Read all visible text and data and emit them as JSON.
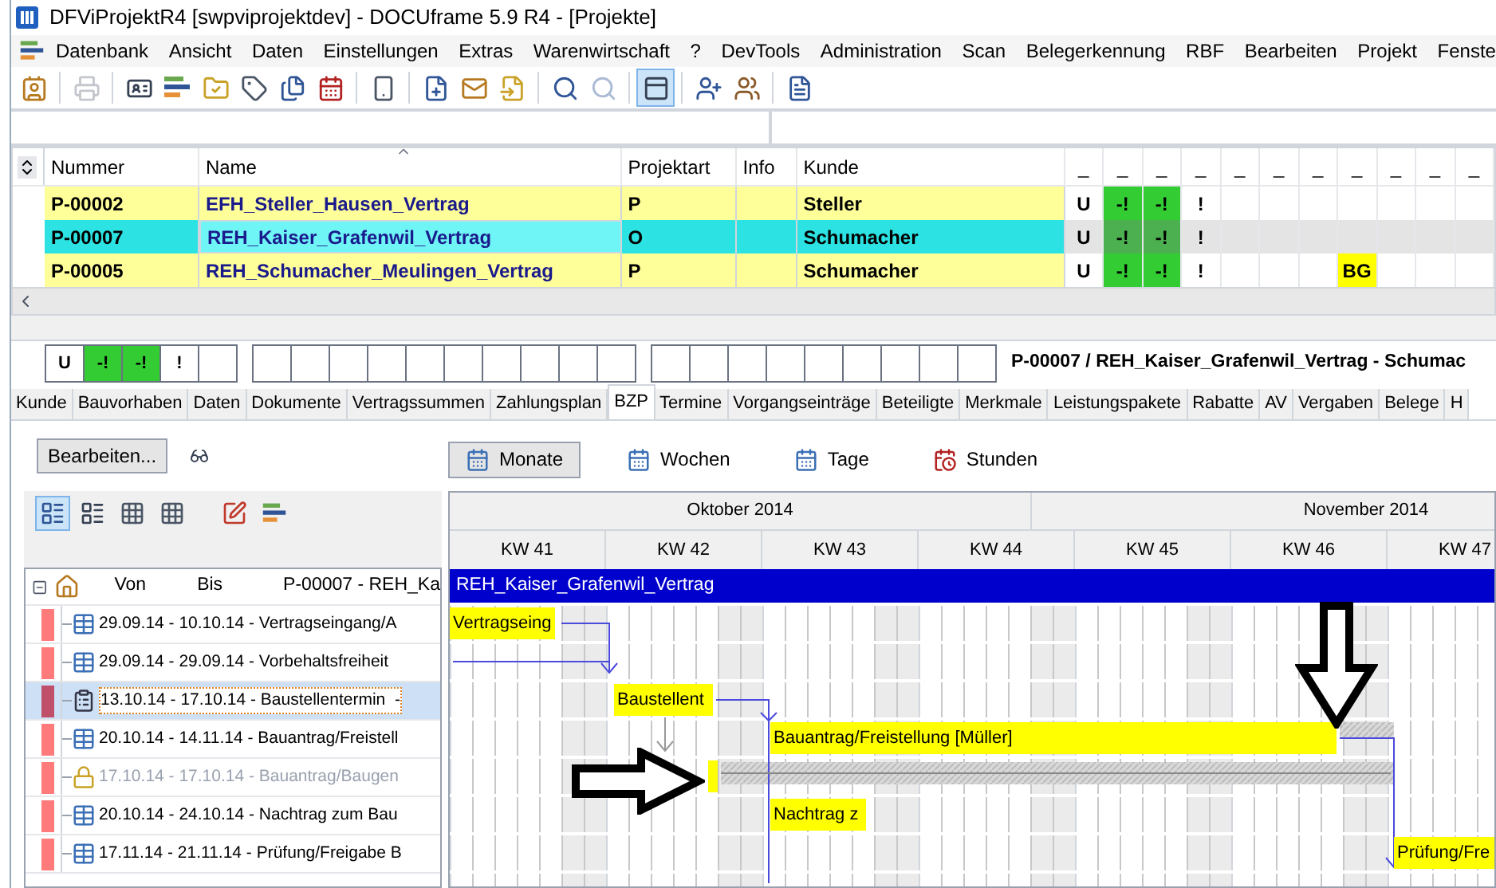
{
  "window": {
    "title": "DFViProjektR4 [swpviprojektdev] - DOCUframe 5.9 R4 - [Projekte]"
  },
  "menu": [
    "Datenbank",
    "Ansicht",
    "Daten",
    "Einstellungen",
    "Extras",
    "Warenwirtschaft",
    "?",
    "DevTools",
    "Administration",
    "Scan",
    "Belegerkennung",
    "RBF",
    "Bearbeiten",
    "Projekt",
    "Fenste"
  ],
  "toolbar": [
    {
      "kind": "contacts",
      "disabled": false,
      "selected": false
    },
    {
      "kind": "separator"
    },
    {
      "kind": "printer",
      "disabled": true,
      "selected": false
    },
    {
      "kind": "separator"
    },
    {
      "kind": "card",
      "disabled": false,
      "selected": false
    },
    {
      "kind": "bars",
      "disabled": false,
      "selected": false
    },
    {
      "kind": "folder",
      "disabled": false,
      "selected": false
    },
    {
      "kind": "tag",
      "disabled": false,
      "selected": false
    },
    {
      "kind": "documents",
      "disabled": false,
      "selected": false
    },
    {
      "kind": "calendar",
      "disabled": false,
      "selected": false
    },
    {
      "kind": "separator"
    },
    {
      "kind": "phone",
      "disabled": false,
      "selected": false
    },
    {
      "kind": "separator"
    },
    {
      "kind": "new-document",
      "disabled": false,
      "selected": false
    },
    {
      "kind": "new-mail",
      "disabled": false,
      "selected": false
    },
    {
      "kind": "new-note",
      "disabled": false,
      "selected": false
    },
    {
      "kind": "separator"
    },
    {
      "kind": "search",
      "disabled": false,
      "selected": false
    },
    {
      "kind": "search",
      "disabled": true,
      "selected": false
    },
    {
      "kind": "separator"
    },
    {
      "kind": "panel",
      "disabled": false,
      "selected": true
    },
    {
      "kind": "separator"
    },
    {
      "kind": "user-add",
      "disabled": false,
      "selected": false
    },
    {
      "kind": "users",
      "disabled": false,
      "selected": false
    },
    {
      "kind": "separator"
    },
    {
      "kind": "export",
      "disabled": false,
      "selected": false
    }
  ],
  "table": {
    "columns": [
      "Nummer",
      "Name",
      "Projektart",
      "Info",
      "Kunde"
    ],
    "flag_columns": [
      "_",
      "_",
      "_",
      "_",
      "_",
      "_",
      "_",
      "_",
      "_",
      "_",
      "_"
    ],
    "rows": [
      {
        "nummer": "P-00002",
        "name": "EFH_Steller_Hausen_Vertrag",
        "projektart": "P",
        "kunde": "Steller",
        "selected": false,
        "flags": [
          {
            "kind": "text",
            "text": "U"
          },
          {
            "kind": "ok",
            "text": "-!"
          },
          {
            "kind": "ok",
            "text": "-!"
          },
          {
            "kind": "text",
            "text": "!"
          },
          {
            "kind": "empty"
          },
          {
            "kind": "empty"
          },
          {
            "kind": "empty"
          },
          {
            "kind": "empty"
          },
          {
            "kind": "empty"
          },
          {
            "kind": "empty"
          },
          {
            "kind": "empty"
          }
        ]
      },
      {
        "nummer": "P-00007",
        "name": "REH_Kaiser_Grafenwil_Vertrag",
        "projektart": "O",
        "kunde": "Schumacher",
        "selected": true,
        "flags": [
          {
            "kind": "text",
            "text": "U"
          },
          {
            "kind": "ok",
            "text": "-!"
          },
          {
            "kind": "ok",
            "text": "-!"
          },
          {
            "kind": "text",
            "text": "!"
          },
          {
            "kind": "empty"
          },
          {
            "kind": "empty"
          },
          {
            "kind": "empty"
          },
          {
            "kind": "empty"
          },
          {
            "kind": "empty"
          },
          {
            "kind": "empty"
          },
          {
            "kind": "empty"
          }
        ]
      },
      {
        "nummer": "P-00005",
        "name": "REH_Schumacher_Meulingen_Vertrag",
        "projektart": "P",
        "kunde": "Schumacher",
        "selected": false,
        "flags": [
          {
            "kind": "text",
            "text": "U"
          },
          {
            "kind": "ok",
            "text": "-!"
          },
          {
            "kind": "ok",
            "text": "-!"
          },
          {
            "kind": "text",
            "text": "!"
          },
          {
            "kind": "empty"
          },
          {
            "kind": "empty"
          },
          {
            "kind": "empty"
          },
          {
            "kind": "warn",
            "text": "BG"
          },
          {
            "kind": "empty"
          },
          {
            "kind": "empty"
          },
          {
            "kind": "empty"
          }
        ]
      }
    ]
  },
  "detail": {
    "flag_groups": [
      [
        {
          "kind": "text",
          "text": "U"
        },
        {
          "kind": "ok",
          "text": "-!"
        },
        {
          "kind": "ok",
          "text": "-!"
        },
        {
          "kind": "text",
          "text": "!"
        },
        {
          "kind": "empty"
        }
      ],
      [
        {
          "kind": "empty"
        },
        {
          "kind": "empty"
        },
        {
          "kind": "empty"
        },
        {
          "kind": "empty"
        },
        {
          "kind": "empty"
        },
        {
          "kind": "empty"
        },
        {
          "kind": "empty"
        },
        {
          "kind": "empty"
        },
        {
          "kind": "empty"
        },
        {
          "kind": "empty"
        }
      ],
      [
        {
          "kind": "empty"
        },
        {
          "kind": "empty"
        },
        {
          "kind": "empty"
        },
        {
          "kind": "empty"
        },
        {
          "kind": "empty"
        },
        {
          "kind": "empty"
        },
        {
          "kind": "empty"
        },
        {
          "kind": "empty"
        },
        {
          "kind": "empty"
        }
      ]
    ],
    "title": "P-00007 / REH_Kaiser_Grafenwil_Vertrag - Schumac"
  },
  "tabs": [
    {
      "label": "Kunde",
      "selected": false
    },
    {
      "label": "Bauvorhaben",
      "selected": false
    },
    {
      "label": "Daten",
      "selected": false
    },
    {
      "label": "Dokumente",
      "selected": false
    },
    {
      "label": "Vertragssummen",
      "selected": false
    },
    {
      "label": "Zahlungsplan",
      "selected": false
    },
    {
      "label": "BZP",
      "selected": true
    },
    {
      "label": "Termine",
      "selected": false
    },
    {
      "label": "Vorgangseinträge",
      "selected": false
    },
    {
      "label": "Beteiligte",
      "selected": false
    },
    {
      "label": "Merkmale",
      "selected": false
    },
    {
      "label": "Leistungspakete",
      "selected": false
    },
    {
      "label": "Rabatte",
      "selected": false
    },
    {
      "label": "AV",
      "selected": false
    },
    {
      "label": "Vergaben",
      "selected": false
    },
    {
      "label": "Belege",
      "selected": false
    },
    {
      "label": "H",
      "selected": false
    }
  ],
  "edit_button": "Bearbeiten...",
  "tree_tools": [
    {
      "kind": "gantt",
      "selected": true
    },
    {
      "kind": "form",
      "selected": false
    },
    {
      "kind": "table",
      "selected": false
    },
    {
      "kind": "table",
      "selected": false
    },
    {
      "kind": "edit",
      "selected": false
    },
    {
      "kind": "bars",
      "selected": false
    }
  ],
  "tree": {
    "expanded": true,
    "von": "Von",
    "bis": "Bis",
    "title": "P-00007 - REH_Ka",
    "rows": [
      {
        "kind": "calendar",
        "text": "29.09.14 - 10.10.14 - Vertragseingang/A",
        "selected": false,
        "disabled": false
      },
      {
        "kind": "calendar",
        "text": "29.09.14 - 29.09.14 - Vorbehaltsfreiheit",
        "selected": false,
        "disabled": false
      },
      {
        "kind": "clipboard",
        "text": "13.10.14 - 17.10.14 - Baustellentermin  -",
        "selected": true,
        "disabled": false
      },
      {
        "kind": "calendar",
        "text": "20.10.14 - 14.11.14 - Bauantrag/Freistell",
        "selected": false,
        "disabled": false
      },
      {
        "kind": "lock",
        "text": "17.10.14 - 17.10.14 - Bauantrag/Baugen",
        "selected": false,
        "disabled": true
      },
      {
        "kind": "calendar",
        "text": "20.10.14 - 24.10.14 - Nachtrag zum Bau",
        "selected": false,
        "disabled": false
      },
      {
        "kind": "calendar",
        "text": "17.11.14 - 21.11.14 - Prüfung/Freigabe B",
        "selected": false,
        "disabled": false
      }
    ]
  },
  "views": [
    {
      "kind": "grid",
      "label": "Monate",
      "selected": true
    },
    {
      "kind": "grid",
      "label": "Wochen",
      "selected": false
    },
    {
      "kind": "grid",
      "label": "Tage",
      "selected": false
    },
    {
      "kind": "clock",
      "label": "Stunden",
      "selected": false
    }
  ],
  "gantt": {
    "months": [
      "Oktober 2014",
      "November 2014"
    ],
    "weeks": [
      "KW 41",
      "KW 42",
      "KW 43",
      "KW 44",
      "KW 45",
      "KW 46",
      "KW 47"
    ],
    "project": "REH_Kaiser_Grafenwil_Vertrag",
    "bars": [
      "Vertragseing",
      "Baustellent",
      "Bauantrag/Freistellung [Müller]",
      "Nachtrag z",
      "Prüfung/Fre"
    ]
  }
}
